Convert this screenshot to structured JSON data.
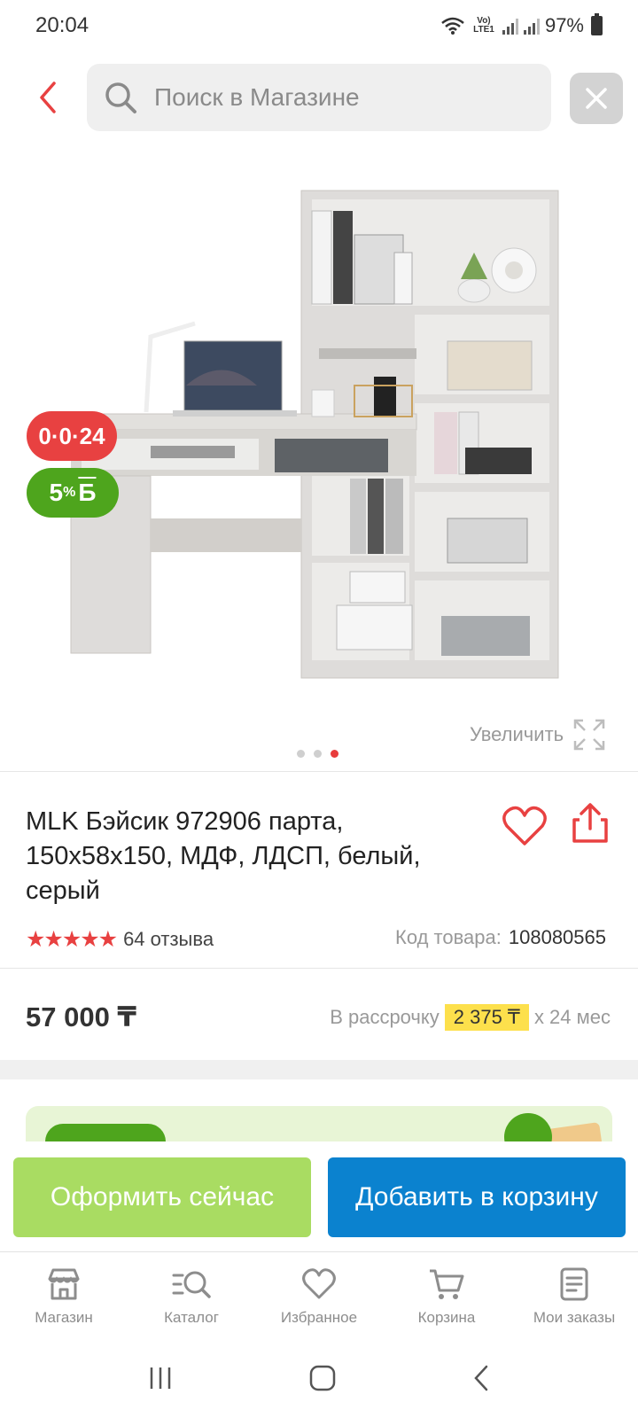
{
  "status_bar": {
    "time": "20:04",
    "network_label": "Vo) LTE1",
    "battery": "97%"
  },
  "search": {
    "placeholder": "Поиск в Магазине"
  },
  "product": {
    "badge_installment": "0·0·24",
    "badge_bonus_percent": "5",
    "badge_bonus_unit": "%",
    "badge_bonus_symbol": "Б",
    "zoom_label": "Увеличить",
    "image_count": 3,
    "active_image": 3,
    "title": "MLK Бэйсик 972906 парта, 150х58х150, МДФ, ЛДСП, белый, серый",
    "rating": 5,
    "reviews": "64 отзыва",
    "sku_label": "Код товара:",
    "sku_value": "108080565",
    "price": "57 000 ₸",
    "installment_prefix": "В рассрочку",
    "installment_amount": "2 375 ₸",
    "installment_suffix": "х 24 мес"
  },
  "actions": {
    "buy_now": "Оформить сейчас",
    "add_to_cart": "Добавить в корзину"
  },
  "bottom_nav": {
    "items": [
      {
        "label": "Магазин",
        "icon": "shop-icon"
      },
      {
        "label": "Каталог",
        "icon": "catalog-search-icon"
      },
      {
        "label": "Избранное",
        "icon": "heart-icon"
      },
      {
        "label": "Корзина",
        "icon": "cart-icon"
      },
      {
        "label": "Мои заказы",
        "icon": "orders-icon"
      }
    ]
  },
  "colors": {
    "accent_red": "#e84141",
    "bonus_green": "#4ea51d",
    "buy_now_green": "#a9dc62",
    "cart_blue": "#0b82cf",
    "installment_yellow": "#fde04c"
  }
}
